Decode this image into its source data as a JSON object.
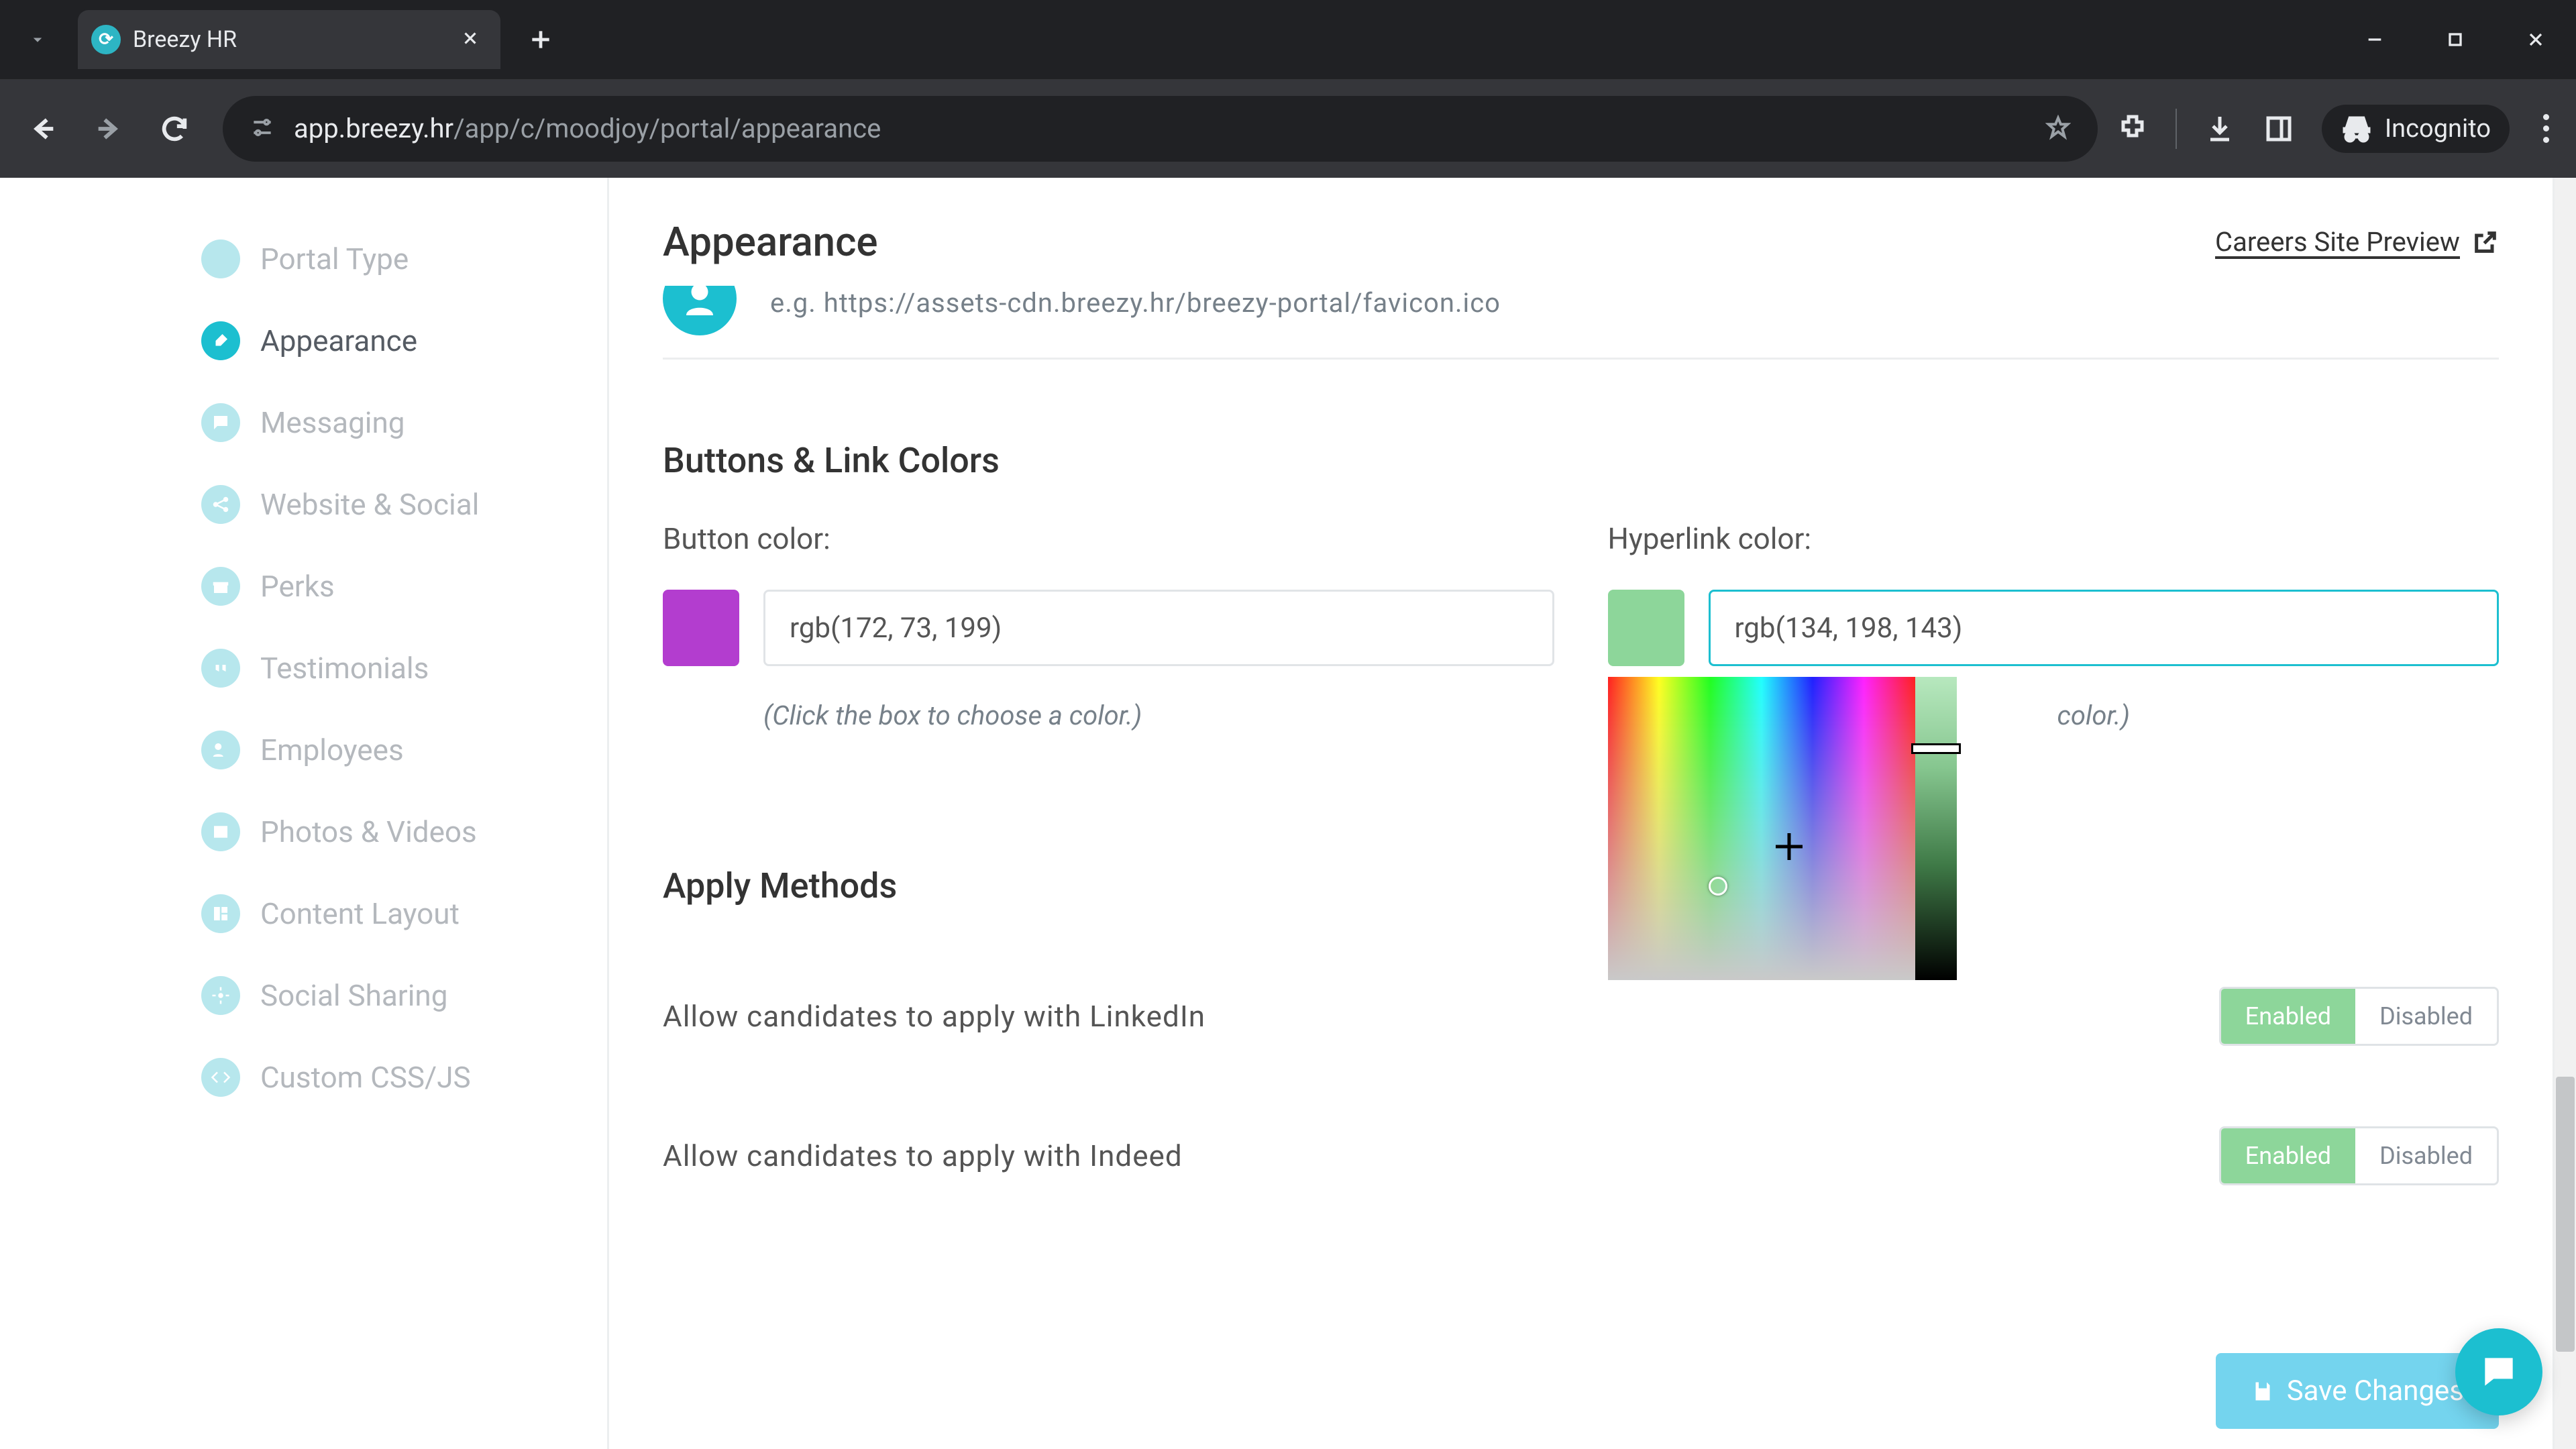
{
  "browser": {
    "tab_title": "Breezy HR",
    "url_host": "app.breezy.hr",
    "url_path": "/app/c/moodjoy/portal/appearance",
    "incognito_label": "Incognito"
  },
  "sidebar": {
    "items": [
      {
        "label": "Portal Type"
      },
      {
        "label": "Appearance"
      },
      {
        "label": "Messaging"
      },
      {
        "label": "Website & Social"
      },
      {
        "label": "Perks"
      },
      {
        "label": "Testimonials"
      },
      {
        "label": "Employees"
      },
      {
        "label": "Photos & Videos"
      },
      {
        "label": "Content Layout"
      },
      {
        "label": "Social Sharing"
      },
      {
        "label": "Custom CSS/JS"
      }
    ],
    "active_index": 1
  },
  "header": {
    "title": "Appearance",
    "preview_label": "Careers Site Preview"
  },
  "favicon": {
    "placeholder": "e.g. https://assets-cdn.breezy.hr/breezy-portal/favicon.ico"
  },
  "colors": {
    "section_title": "Buttons & Link Colors",
    "button": {
      "label": "Button color:",
      "value": "rgb(172, 73, 199)",
      "swatch": "#b33dcf",
      "hint": "(Click the box to choose a color.)"
    },
    "hyperlink": {
      "label": "Hyperlink color:",
      "value": "rgb(134, 198, 143)",
      "swatch": "#8dd69a",
      "hint_suffix": "color.)"
    }
  },
  "apply": {
    "section_title": "Apply Methods",
    "linkedin_label": "Allow candidates to apply with LinkedIn",
    "indeed_label": "Allow candidates to apply with Indeed",
    "enabled_label": "Enabled",
    "disabled_label": "Disabled"
  },
  "save_label": "Save Changes"
}
